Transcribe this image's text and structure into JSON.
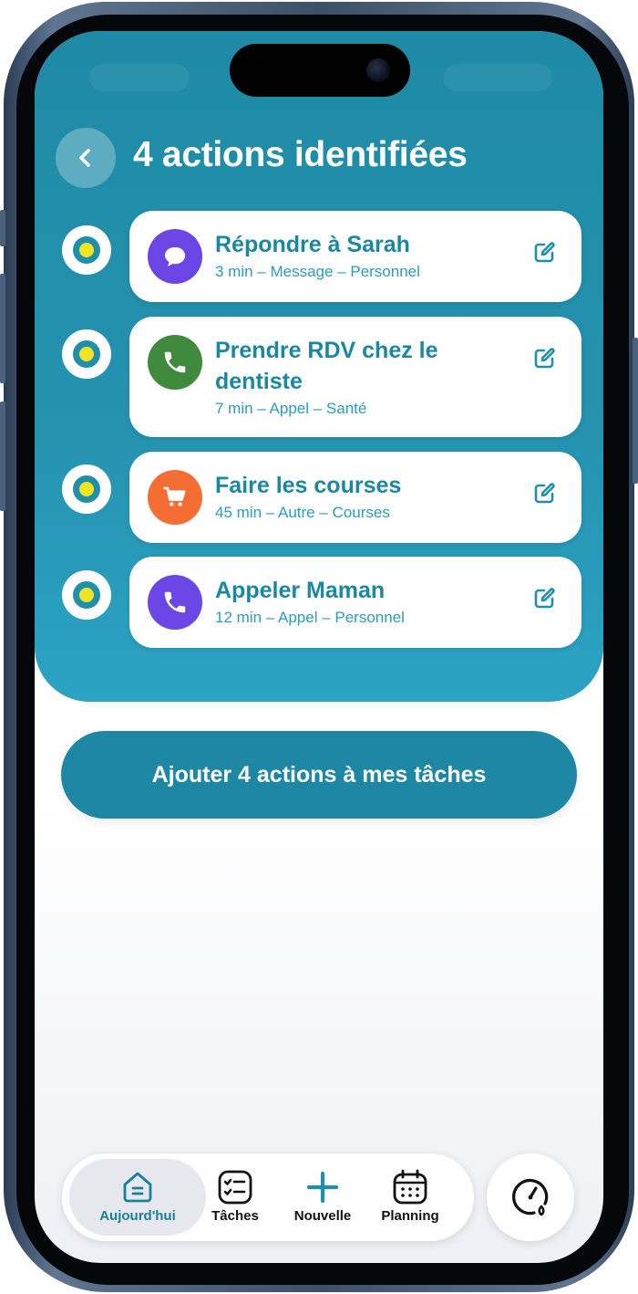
{
  "header": {
    "title": "4 actions identifiées"
  },
  "actions": [
    {
      "title": "Répondre à Sarah",
      "meta": "3 min – Message – Personnel",
      "icon": "message-bubble-icon",
      "color": "#6c46e4"
    },
    {
      "title": "Prendre RDV chez le dentiste",
      "meta": "7 min – Appel – Santé",
      "icon": "phone-icon",
      "color": "#3f8a3c"
    },
    {
      "title": "Faire les courses",
      "meta": "45 min – Autre – Courses",
      "icon": "cart-icon",
      "color": "#f46d33"
    },
    {
      "title": "Appeler Maman",
      "meta": "12 min – Appel – Personnel",
      "icon": "phone-icon",
      "color": "#6c46e4"
    }
  ],
  "cta": {
    "label": "Ajouter 4 actions à mes tâches"
  },
  "tabs": [
    {
      "label": "Aujourd'hui",
      "icon": "home-icon",
      "active": true
    },
    {
      "label": "Tâches",
      "icon": "checklist-icon"
    },
    {
      "label": "Nouvelle",
      "icon": "plus-icon"
    },
    {
      "label": "Planning",
      "icon": "calendar-icon"
    }
  ],
  "side_button": {
    "icon": "gauge-icon"
  },
  "colors": {
    "accent": "#1e88a4",
    "title_text": "#1a87a3",
    "radio_dot": "#f1e424"
  }
}
